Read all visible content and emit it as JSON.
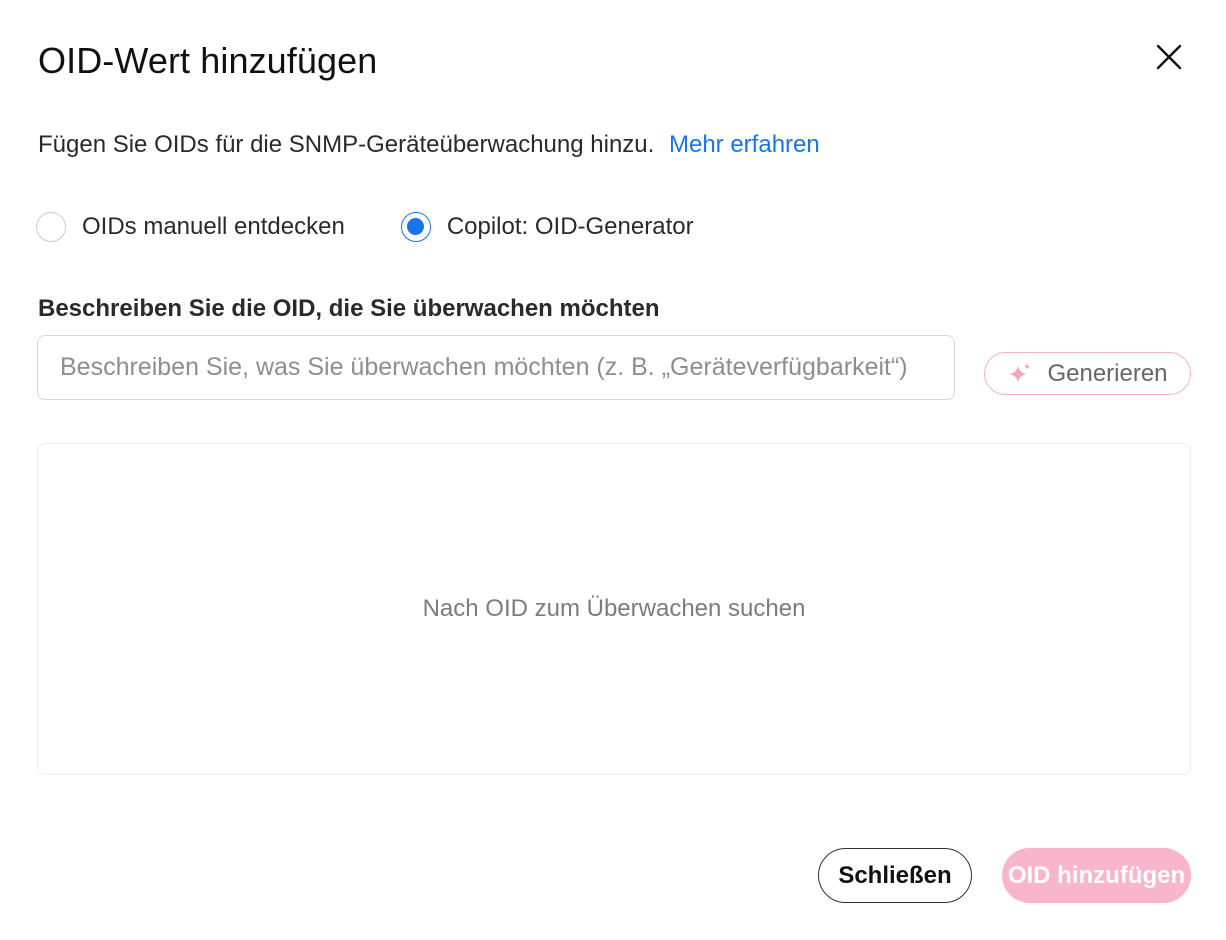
{
  "dialog": {
    "title": "OID-Wert hinzufügen",
    "intro_text": "Fügen Sie OIDs für die SNMP-Geräteüberwachung hinzu.",
    "learn_more_link": "Mehr erfahren"
  },
  "mode": {
    "options": [
      {
        "label": "OIDs manuell entdecken",
        "selected": false
      },
      {
        "label": "Copilot: OID-Generator",
        "selected": true
      }
    ]
  },
  "describe": {
    "label": "Beschreiben Sie die OID, die Sie überwachen möchten",
    "placeholder": "Beschreiben Sie, was Sie überwachen möchten (z. B. „Geräteverfügbarkeit“)",
    "value": "",
    "generate_button": "Generieren"
  },
  "results": {
    "empty_text": "Nach OID zum Überwachen suchen"
  },
  "footer": {
    "close_button": "Schließen",
    "add_button": "OID hinzufügen"
  },
  "icons": {
    "close": "close-icon",
    "generate": "sparkle-icon"
  },
  "colors": {
    "link": "#1a73e8",
    "radio_selected": "#1a73e8",
    "accent_pink": "#f9b5cc",
    "generate_border": "#f5b3cb"
  }
}
